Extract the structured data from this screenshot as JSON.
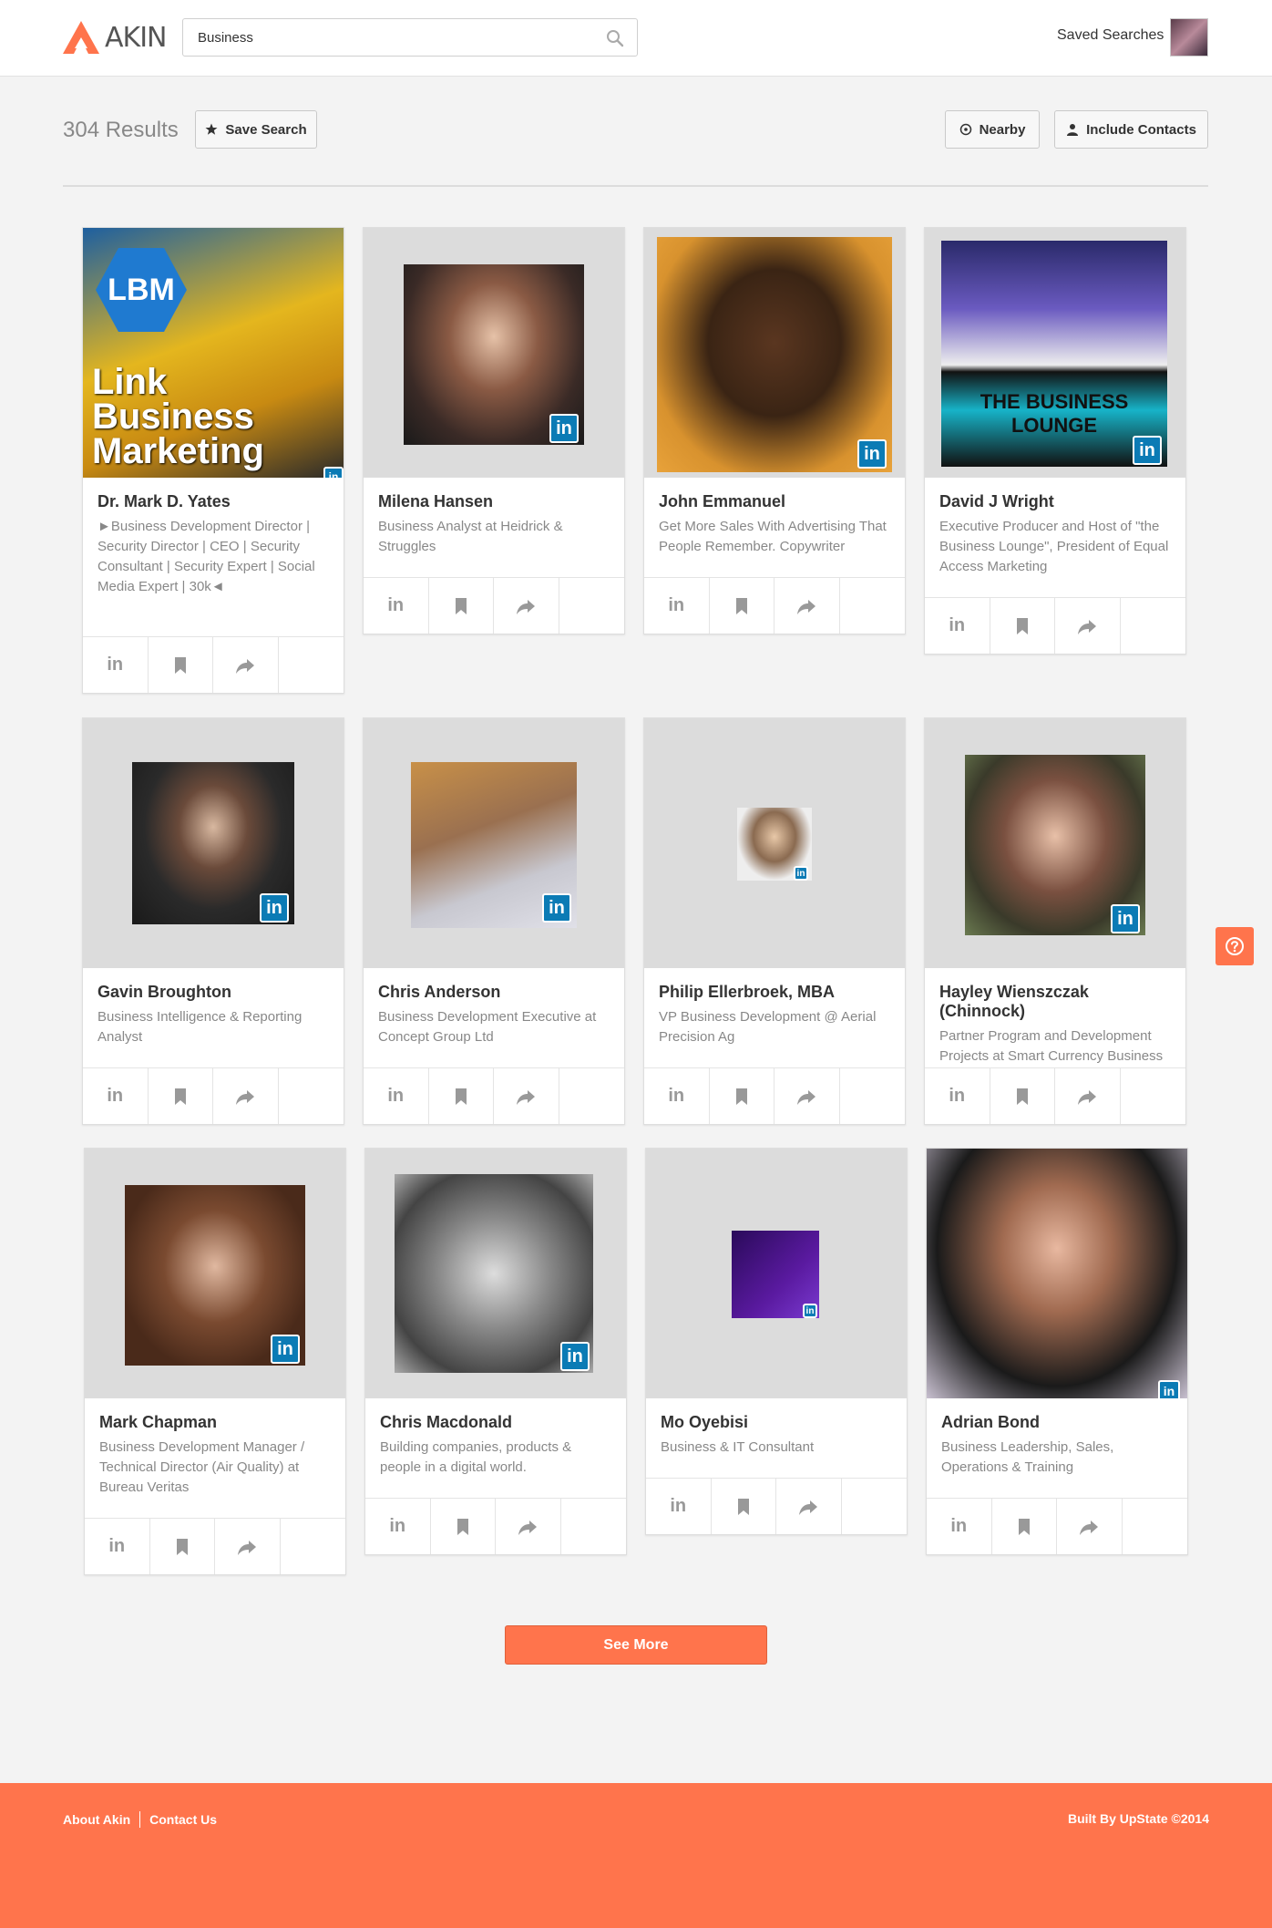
{
  "header": {
    "logo_text": "AKIN",
    "search_value": "Business",
    "saved_searches": "Saved Searches"
  },
  "results": {
    "count_label": "304 Results",
    "save_search": "Save Search",
    "nearby": "Nearby",
    "include_contacts": "Include Contacts"
  },
  "cards": [
    {
      "name": "Dr. Mark D. Yates",
      "title": "►Business Development Director | Security Director | CEO | Security Consultant | Security Expert | Social Media Expert | 30k◄",
      "photo_text": [
        "LBM",
        "Link",
        "Business",
        "Marketing"
      ]
    },
    {
      "name": "Milena Hansen",
      "title": "Business Analyst at Heidrick & Struggles"
    },
    {
      "name": "John Emmanuel",
      "title": "Get More Sales With Advertising That People Remember. Copywriter"
    },
    {
      "name": "David J Wright",
      "title": "Executive Producer and Host of \"the Business Lounge\", President of Equal Access Marketing",
      "photo_text": [
        "THE BUSINESS LOUNGE"
      ]
    },
    {
      "name": "Gavin Broughton",
      "title": "Business Intelligence & Reporting Analyst"
    },
    {
      "name": "Chris Anderson",
      "title": "Business Development Executive at Concept Group Ltd"
    },
    {
      "name": "Philip Ellerbroek, MBA",
      "title": "VP Business Development @ Aerial Precision Ag"
    },
    {
      "name": "Hayley Wienszczak (Chinnock)",
      "title": "Partner Program and Development Projects at Smart Currency Business"
    },
    {
      "name": "Mark Chapman",
      "title": "Business Development Manager / Technical Director (Air Quality) at Bureau Veritas"
    },
    {
      "name": "Chris Macdonald",
      "title": "Building companies, products & people in a digital world."
    },
    {
      "name": "Mo Oyebisi",
      "title": "Business & IT Consultant"
    },
    {
      "name": "Adrian Bond",
      "title": "Business Leadership, Sales, Operations & Training"
    }
  ],
  "linkedin_badge": "in",
  "see_more": "See More",
  "footer": {
    "about": "About Akin",
    "contact": "Contact Us",
    "built_by": "Built By UpState ©2014"
  },
  "colors": {
    "accent": "#ff744c",
    "linkedin": "#0b7bb5"
  }
}
